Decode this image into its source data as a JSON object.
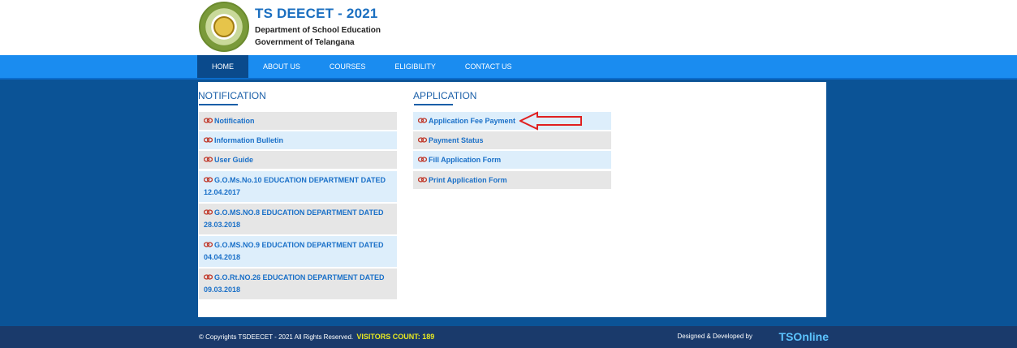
{
  "header": {
    "title": "TS DEECET - 2021",
    "subtitle1": "Department of School Education",
    "subtitle2": "Government of Telangana"
  },
  "nav": [
    {
      "label": "HOME",
      "active": true
    },
    {
      "label": "ABOUT US",
      "active": false
    },
    {
      "label": "COURSES",
      "active": false
    },
    {
      "label": "ELIGIBILITY",
      "active": false
    },
    {
      "label": "CONTACT US",
      "active": false
    }
  ],
  "notification": {
    "title": "NOTIFICATION",
    "items": [
      {
        "label": "Notification"
      },
      {
        "label": "Information Bulletin"
      },
      {
        "label": "User Guide"
      },
      {
        "label": "G.O.Ms.No.10 EDUCATION DEPARTMENT DATED 12.04.2017"
      },
      {
        "label": "G.O.MS.NO.8 EDUCATION DEPARTMENT DATED 28.03.2018"
      },
      {
        "label": "G.O.MS.NO.9 EDUCATION DEPARTMENT DATED 04.04.2018"
      },
      {
        "label": "G.O.Rt.NO.26 EDUCATION DEPARTMENT DATED 09.03.2018"
      }
    ]
  },
  "application": {
    "title": "APPLICATION",
    "items": [
      {
        "label": "Application Fee Payment"
      },
      {
        "label": "Payment Status"
      },
      {
        "label": "Fill Application Form"
      },
      {
        "label": "Print Application Form"
      }
    ]
  },
  "footer": {
    "copyright": "© Copyrights TSDEECET - 2021 All Rights Reserved.",
    "visitors": "VISITORS COUNT: 189",
    "designed": "Designed & Developed by",
    "brand": "TSOnline"
  },
  "colors": {
    "nav_bg": "#1a8cf0",
    "nav_active": "#0a4a8c",
    "body_bg": "#0b5396",
    "link": "#1a70c8",
    "arrow": "#e02020"
  }
}
